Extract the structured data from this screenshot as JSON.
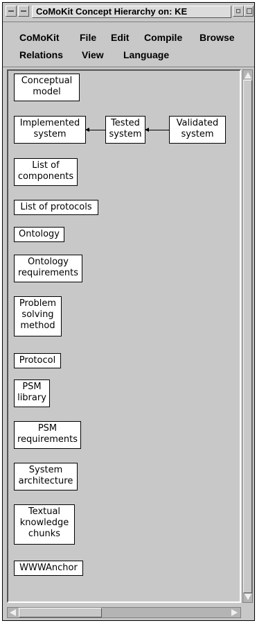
{
  "window": {
    "title": "CoMoKit Concept Hierarchy on: KE"
  },
  "menu": [
    "CoMoKit",
    "File",
    "Edit",
    "Compile",
    "Browse",
    "Relations",
    "View",
    "Language"
  ],
  "nodes": {
    "conceptual_model": "Conceptual\nmodel",
    "implemented_system": "Implemented\nsystem",
    "tested_system": "Tested\nsystem",
    "validated_system": "Validated\nsystem",
    "list_of_components": "List of\ncomponents",
    "list_of_protocols": "List of protocols",
    "ontology": "Ontology",
    "ontology_requirements": "Ontology\nrequirements",
    "problem_solving_method": "Problem\nsolving\nmethod",
    "protocol": "Protocol",
    "psm_library": "PSM\nlibrary",
    "psm_requirements": "PSM\nrequirements",
    "system_architecture": "System\narchitecture",
    "textual_knowledge_chunks": "Textual\nknowledge\nchunks",
    "wwwanchor": "WWWAnchor"
  },
  "colors": {
    "window_bg": "#c8c8c8",
    "node_bg": "#ffffff",
    "border": "#000000"
  }
}
